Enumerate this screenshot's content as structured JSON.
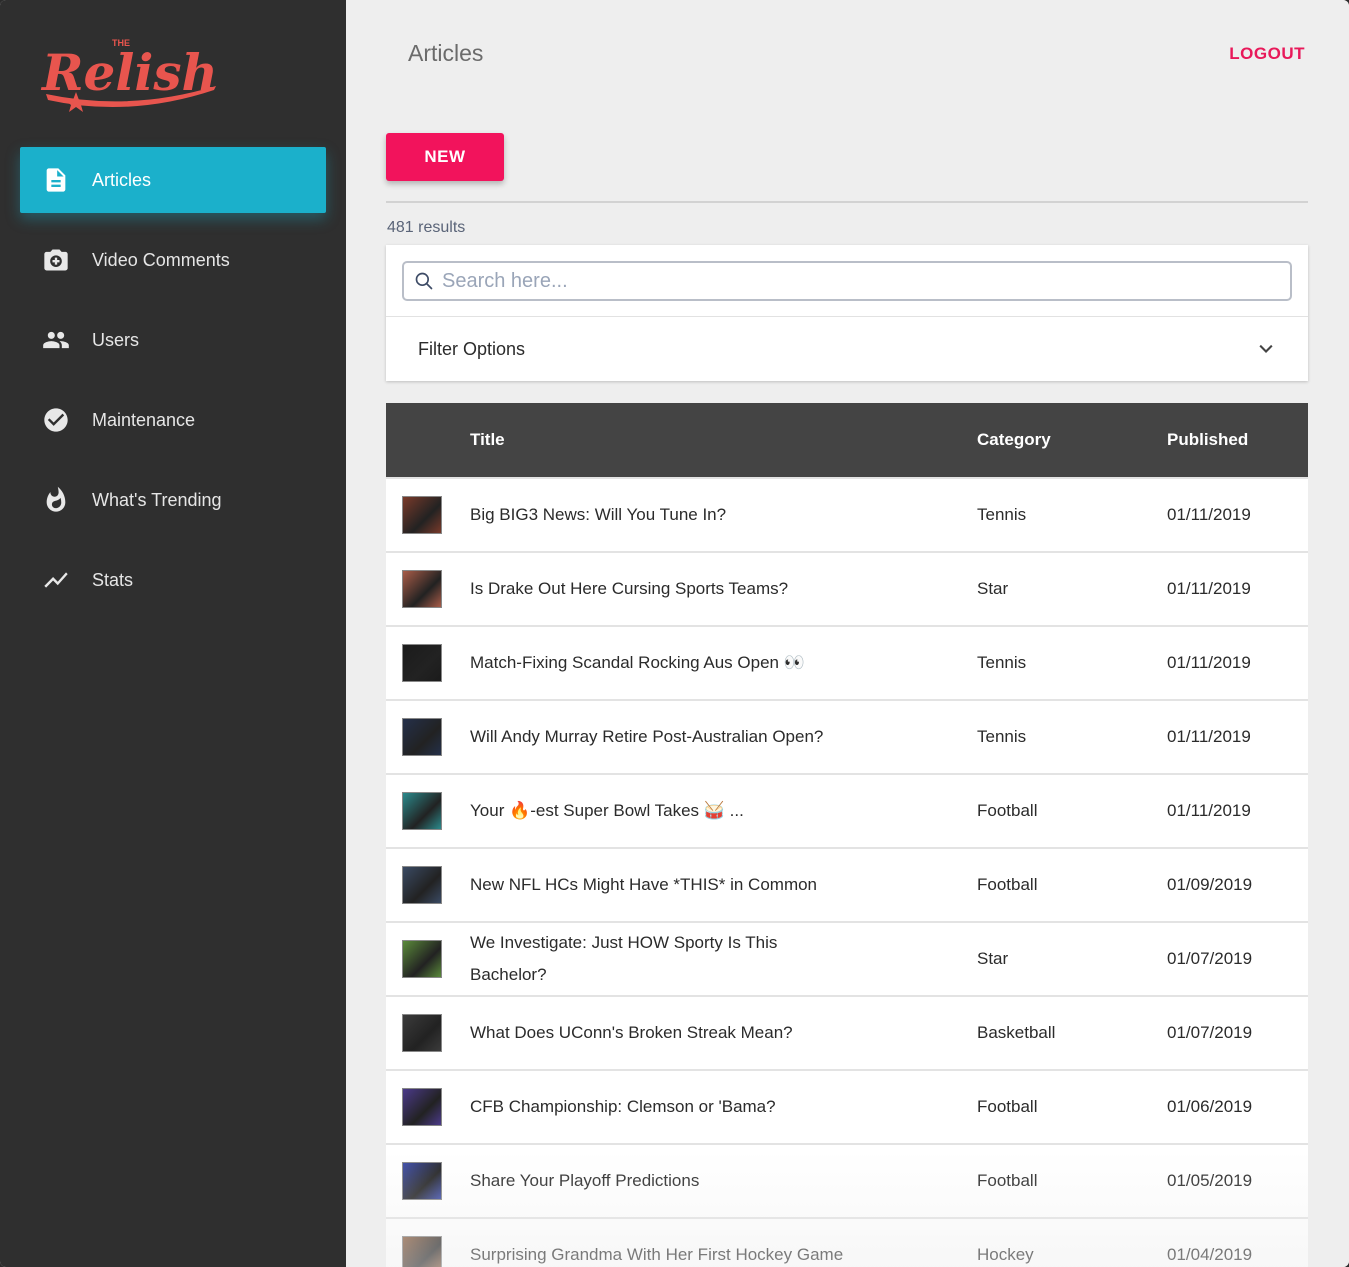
{
  "brand": {
    "logo_text": "Relish",
    "logo_small": "THE",
    "color": "#e8554e"
  },
  "sidebar": {
    "items": [
      {
        "label": "Articles",
        "icon": "document-icon",
        "active": true
      },
      {
        "label": "Video Comments",
        "icon": "camera-icon",
        "active": false
      },
      {
        "label": "Users",
        "icon": "users-icon",
        "active": false
      },
      {
        "label": "Maintenance",
        "icon": "check-circle-icon",
        "active": false
      },
      {
        "label": "What's Trending",
        "icon": "flame-icon",
        "active": false
      },
      {
        "label": "Stats",
        "icon": "trend-line-icon",
        "active": false
      }
    ]
  },
  "header": {
    "title": "Articles",
    "logout_label": "LOGOUT"
  },
  "toolbar": {
    "new_label": "NEW"
  },
  "results_text": "481 results",
  "search": {
    "placeholder": "Search here...",
    "value": ""
  },
  "filter": {
    "label": "Filter Options"
  },
  "table": {
    "headers": {
      "title": "Title",
      "category": "Category",
      "published": "Published"
    },
    "rows": [
      {
        "title": "Big BIG3 News: Will You Tune In?",
        "category": "Tennis",
        "published": "01/11/2019",
        "thumb": "#7a3a2a"
      },
      {
        "title": "Is Drake Out Here Cursing Sports Teams?",
        "category": "Star",
        "published": "01/11/2019",
        "thumb": "#a85c48"
      },
      {
        "title": "Match-Fixing Scandal Rocking Aus Open 👀",
        "category": "Tennis",
        "published": "01/11/2019",
        "thumb": "#1b1b1b"
      },
      {
        "title": "Will Andy Murray Retire Post-Australian Open?",
        "category": "Tennis",
        "published": "01/11/2019",
        "thumb": "#24304a"
      },
      {
        "title": "Your 🔥-est Super Bowl Takes 🥁 ...",
        "category": "Football",
        "published": "01/11/2019",
        "thumb": "#2b8a8c"
      },
      {
        "title": "New NFL HCs Might Have *THIS* in Common",
        "category": "Football",
        "published": "01/09/2019",
        "thumb": "#3a4a63"
      },
      {
        "title": "We Investigate: Just HOW Sporty Is This Bachelor?",
        "category": "Star",
        "published": "01/07/2019",
        "thumb": "#5a8a3a"
      },
      {
        "title": "What Does UConn's Broken Streak Mean?",
        "category": "Basketball",
        "published": "01/07/2019",
        "thumb": "#3b3b3b"
      },
      {
        "title": "CFB Championship: Clemson or 'Bama?",
        "category": "Football",
        "published": "01/06/2019",
        "thumb": "#4b3a8a"
      },
      {
        "title": "Share Your Playoff Predictions",
        "category": "Football",
        "published": "01/05/2019",
        "thumb": "#3a4aa8"
      },
      {
        "title": "Surprising Grandma With Her First Hockey Game",
        "category": "Hockey",
        "published": "01/04/2019",
        "thumb": "#8a5a3a"
      }
    ]
  }
}
